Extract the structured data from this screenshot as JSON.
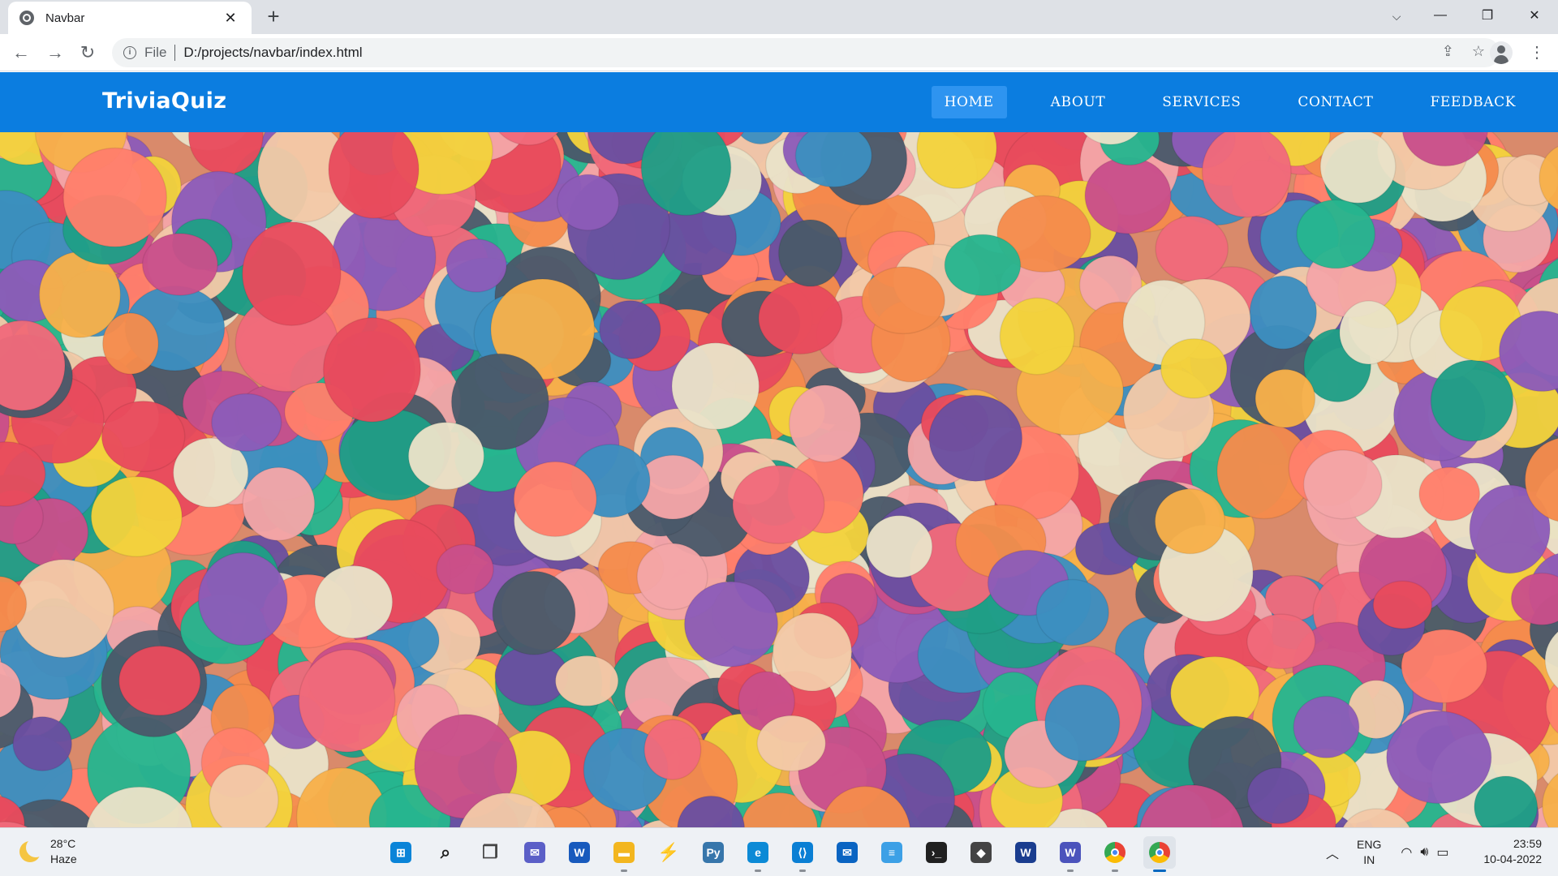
{
  "browser": {
    "tab_title": "Navbar",
    "new_tab_label": "+",
    "url_scheme": "File",
    "url": "D:/projects/navbar/index.html"
  },
  "site": {
    "brand": "TriviaQuiz",
    "nav_items": [
      {
        "label": "HOME",
        "active": true
      },
      {
        "label": "ABOUT",
        "active": false
      },
      {
        "label": "SERVICES",
        "active": false
      },
      {
        "label": "CONTACT",
        "active": false
      },
      {
        "label": "FEEDBACK",
        "active": false
      }
    ],
    "nav_color": "#0b7de0",
    "active_color": "#2e94f0"
  },
  "taskbar": {
    "weather_temp": "28°C",
    "weather_desc": "Haze",
    "lang_primary": "ENG",
    "lang_secondary": "IN",
    "time": "23:59",
    "date": "10-04-2022",
    "apps": [
      {
        "name": "start-icon",
        "color": "#0a84d8"
      },
      {
        "name": "search-icon",
        "color": "#1f1f1f"
      },
      {
        "name": "task-view-icon",
        "color": "#444"
      },
      {
        "name": "chat-icon",
        "color": "#5b5fc7"
      },
      {
        "name": "word-icon",
        "color": "#185abd"
      },
      {
        "name": "file-explorer-icon",
        "color": "#f3b61f"
      },
      {
        "name": "lightning-app-icon",
        "color": "#222"
      },
      {
        "name": "python-icon",
        "color": "#3776ab"
      },
      {
        "name": "edge-icon",
        "color": "#0c8ad6"
      },
      {
        "name": "vscode-icon",
        "color": "#0a7fd4"
      },
      {
        "name": "mail-icon",
        "color": "#0a64c2"
      },
      {
        "name": "notepad-icon",
        "color": "#3ca0e6"
      },
      {
        "name": "terminal-icon",
        "color": "#202020"
      },
      {
        "name": "dropbox-icon",
        "color": "#444"
      },
      {
        "name": "wordweb-icon",
        "color": "#1a3d8f"
      },
      {
        "name": "teams-icon",
        "color": "#4b53bc"
      },
      {
        "name": "chrome-icon",
        "color": "#e8453c"
      },
      {
        "name": "chrome-active-icon",
        "color": "#e8453c"
      }
    ]
  }
}
